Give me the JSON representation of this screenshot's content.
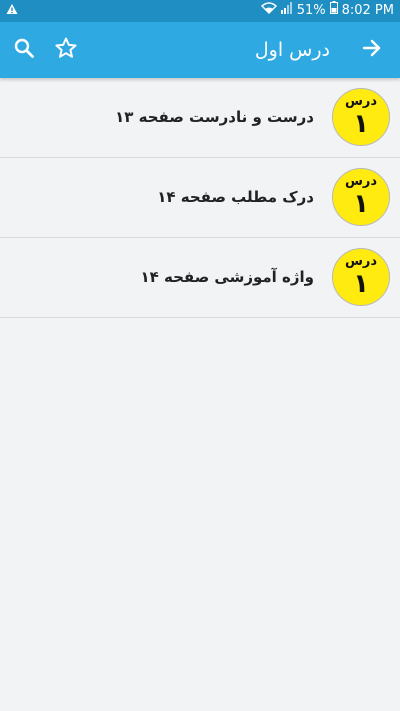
{
  "status_bar": {
    "battery": "51%",
    "time": "8:02 PM",
    "icons": [
      "warning-icon",
      "wifi-icon",
      "signal-icon",
      "battery-icon"
    ]
  },
  "app_bar": {
    "title": "درس اول",
    "icons": [
      "arrow-right-icon",
      "star-outline-icon",
      "search-icon"
    ]
  },
  "list": {
    "items": [
      {
        "badge_label": "درس",
        "badge_number": "۱",
        "text": "درست و نادرست صفحه ۱۳"
      },
      {
        "badge_label": "درس",
        "badge_number": "۱",
        "text": "درک مطلب صفحه ۱۴"
      },
      {
        "badge_label": "درس",
        "badge_number": "۱",
        "text": "واژه آموزشی صفحه ۱۴"
      }
    ]
  },
  "colors": {
    "status_bar": "#1f8fc3",
    "app_bar": "#2fa9e1",
    "badge": "#ffeb10",
    "background": "#f1f3f5"
  }
}
